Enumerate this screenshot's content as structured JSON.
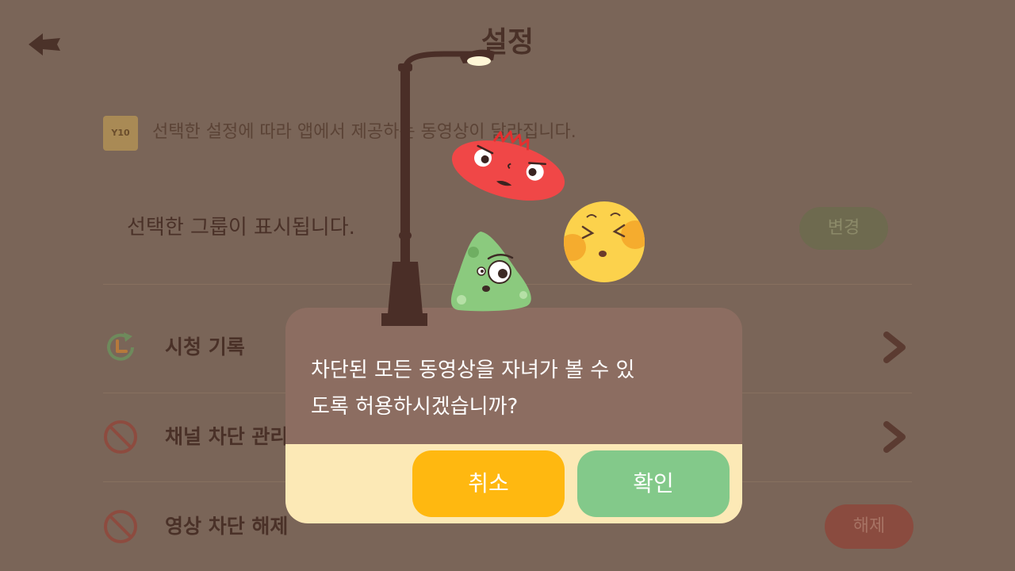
{
  "header": {
    "title": "설정",
    "back_icon": "back-arrow-icon"
  },
  "info": {
    "badge": "Y10",
    "text": "선택한 설정에 따라 앱에서 제공하는 동영상이 달라집니다."
  },
  "group": {
    "text": "선택한 그룹이 표시됩니다.",
    "change_label": "변경"
  },
  "menu": [
    {
      "label": "시청 기록",
      "icon": "history-icon",
      "trailing_icon": "chevron-right-icon"
    },
    {
      "label": "채널 차단 관리",
      "icon": "block-icon",
      "trailing_icon": "chevron-right-icon"
    },
    {
      "label": "영상 차단 해제",
      "icon": "block-icon",
      "action_label": "해제"
    }
  ],
  "dialog": {
    "message_lines": [
      "차단된 모든 동영상을 자녀가 볼 수 있",
      "도록 허용하시겠습니까?"
    ],
    "cancel_label": "취소",
    "confirm_label": "확인"
  },
  "colors": {
    "background_dimmed": "#7a6558",
    "dialog_top": "#8c6d61",
    "dialog_footer": "#fce9b6",
    "cancel_button": "#ffb810",
    "confirm_button": "#83c98a"
  }
}
